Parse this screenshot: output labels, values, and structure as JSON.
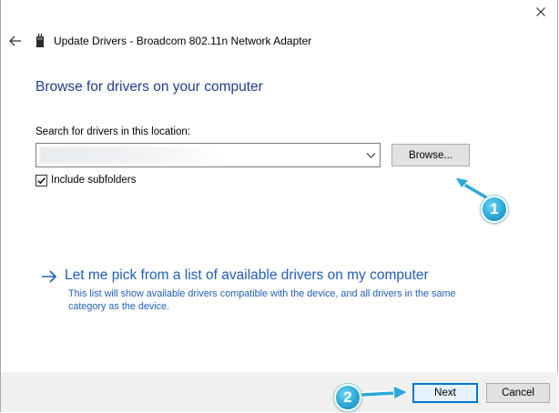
{
  "window": {
    "title": "Update Drivers - Broadcom 802.11n Network Adapter"
  },
  "main": {
    "heading": "Browse for drivers on your computer",
    "search_label": "Search for drivers in this location:",
    "path_value": "",
    "browse_label": "Browse...",
    "include_subfolders_label": "Include subfolders",
    "include_subfolders_checked": true,
    "pick_link_title": "Let me pick from a list of available drivers on my computer",
    "pick_link_description": "This list will show available drivers compatible with the device, and all drivers in the same category as the device."
  },
  "footer": {
    "next_label": "Next",
    "cancel_label": "Cancel"
  },
  "annotations": {
    "badge_1": "1",
    "badge_2": "2"
  },
  "colors": {
    "heading": "#1e3e91",
    "link": "#1e5fbf",
    "annotation": "#2aa9d8",
    "primary_button_border": "#0078d7"
  },
  "icons": {
    "close": "close-icon",
    "back": "back-arrow-icon",
    "device": "network-adapter-icon",
    "dropdown": "chevron-down-icon",
    "link_arrow": "arrow-right-icon"
  }
}
